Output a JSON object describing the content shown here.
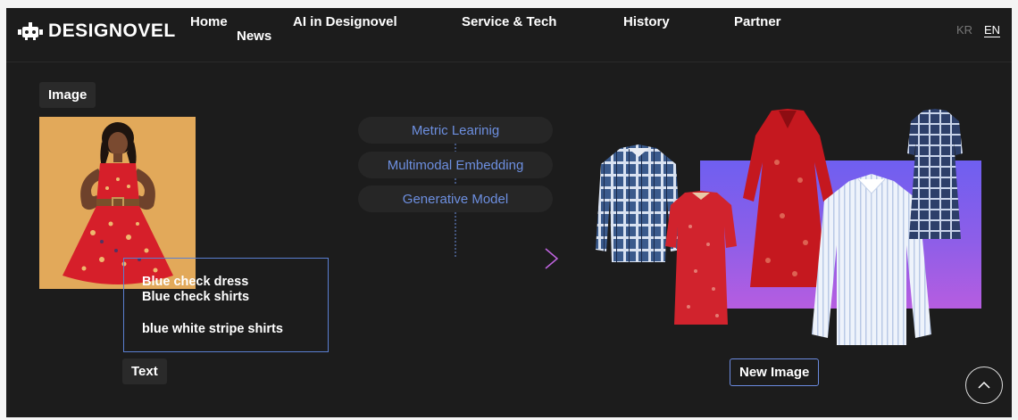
{
  "header": {
    "logo_text": "DESIGNOVEL",
    "nav": {
      "home": "Home",
      "news": "News",
      "ai": "AI in Designovel",
      "service": "Service & Tech",
      "history": "History",
      "partner": "Partner"
    },
    "lang": {
      "kr": "KR",
      "en": "EN"
    }
  },
  "main": {
    "image_tag": "Image",
    "text_tag": "Text",
    "text_queries": [
      "Blue check dress",
      "Blue check shirts",
      "blue white stripe shirts"
    ],
    "methods": [
      "Metric Learinig",
      "Multimodal Embedding",
      "Generative Model"
    ],
    "new_image_button": "New Image"
  },
  "colors": {
    "background": "#1c1c1c",
    "accent_blue": "#6d8fe0",
    "gradient_start": "#6f5ff0",
    "gradient_end": "#b65de0"
  },
  "icons": {
    "scroll_top": "chevron-up-icon",
    "logo": "robot-icon"
  }
}
